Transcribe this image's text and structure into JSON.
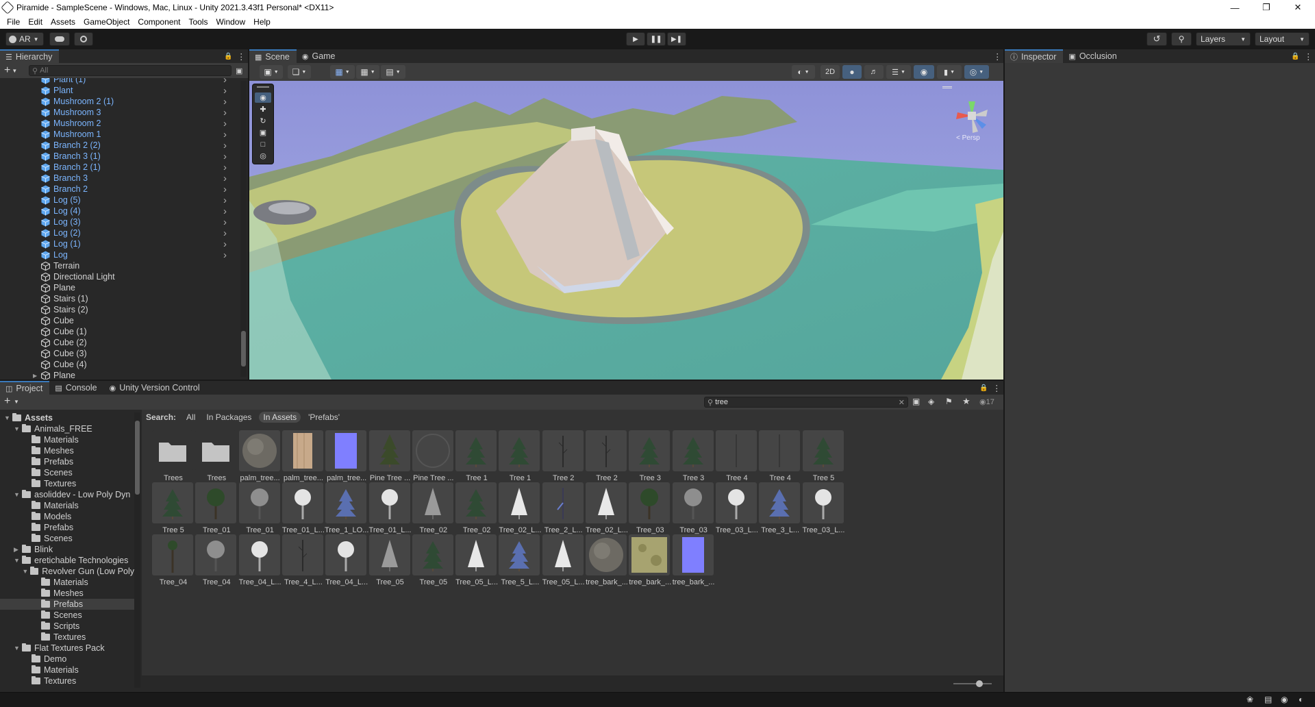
{
  "window": {
    "title": "Piramide - SampleScene - Windows, Mac, Linux - Unity 2021.3.43f1 Personal* <DX11>"
  },
  "menu": [
    "File",
    "Edit",
    "Assets",
    "GameObject",
    "Component",
    "Tools",
    "Window",
    "Help"
  ],
  "toolbar": {
    "account": "AR",
    "layers": "Layers",
    "layout": "Layout"
  },
  "hierarchy": {
    "tab": "Hierarchy",
    "search_placeholder": "All",
    "items": [
      {
        "label": "Plant (1)",
        "blue": true
      },
      {
        "label": "Plant",
        "blue": true
      },
      {
        "label": "Mushroom 2 (1)",
        "blue": true
      },
      {
        "label": "Mushroom 3",
        "blue": true
      },
      {
        "label": "Mushroom 2",
        "blue": true
      },
      {
        "label": "Mushroom 1",
        "blue": true
      },
      {
        "label": "Branch 2 (2)",
        "blue": true
      },
      {
        "label": "Branch 3 (1)",
        "blue": true
      },
      {
        "label": "Branch 2 (1)",
        "blue": true
      },
      {
        "label": "Branch 3",
        "blue": true
      },
      {
        "label": "Branch 2",
        "blue": true
      },
      {
        "label": "Log (5)",
        "blue": true
      },
      {
        "label": "Log (4)",
        "blue": true
      },
      {
        "label": "Log (3)",
        "blue": true
      },
      {
        "label": "Log (2)",
        "blue": true
      },
      {
        "label": "Log (1)",
        "blue": true
      },
      {
        "label": "Log",
        "blue": true
      },
      {
        "label": "Terrain",
        "blue": false
      },
      {
        "label": "Directional Light",
        "blue": false
      },
      {
        "label": "Plane",
        "blue": false
      },
      {
        "label": "Stairs (1)",
        "blue": false
      },
      {
        "label": "Stairs (2)",
        "blue": false
      },
      {
        "label": "Cube",
        "blue": false
      },
      {
        "label": "Cube (1)",
        "blue": false
      },
      {
        "label": "Cube (2)",
        "blue": false
      },
      {
        "label": "Cube (3)",
        "blue": false
      },
      {
        "label": "Cube (4)",
        "blue": false
      },
      {
        "label": "Plane",
        "blue": false
      }
    ]
  },
  "scene": {
    "tabs": [
      "Scene",
      "Game"
    ],
    "mode_2d": "2D",
    "gizmo_label": "< Persp"
  },
  "inspector": {
    "tabs": [
      "Inspector",
      "Occlusion"
    ]
  },
  "project": {
    "tabs": [
      "Project",
      "Console",
      "Unity Version Control"
    ],
    "search_value": "tree",
    "search_label": "Search:",
    "filters": [
      "All",
      "In Packages",
      "In Assets",
      "'Prefabs'"
    ],
    "result_count": "17",
    "tree": [
      {
        "label": "Assets",
        "depth": 0,
        "open": true,
        "bold": true
      },
      {
        "label": "Animals_FREE",
        "depth": 1,
        "open": true
      },
      {
        "label": "Materials",
        "depth": 2
      },
      {
        "label": "Meshes",
        "depth": 2
      },
      {
        "label": "Prefabs",
        "depth": 2
      },
      {
        "label": "Scenes",
        "depth": 2
      },
      {
        "label": "Textures",
        "depth": 2
      },
      {
        "label": "asoliddev - Low Poly Dyn",
        "depth": 1,
        "open": true
      },
      {
        "label": "Materials",
        "depth": 2
      },
      {
        "label": "Models",
        "depth": 2
      },
      {
        "label": "Prefabs",
        "depth": 2
      },
      {
        "label": "Scenes",
        "depth": 2
      },
      {
        "label": "Blink",
        "depth": 1,
        "open": false
      },
      {
        "label": "eretichable Technologies",
        "depth": 1,
        "open": true
      },
      {
        "label": "Revolver Gun (Low Poly",
        "depth": 2,
        "open": true
      },
      {
        "label": "Materials",
        "depth": 3
      },
      {
        "label": "Meshes",
        "depth": 3
      },
      {
        "label": "Prefabs",
        "depth": 3,
        "selected": true
      },
      {
        "label": "Scenes",
        "depth": 3
      },
      {
        "label": "Scripts",
        "depth": 3
      },
      {
        "label": "Textures",
        "depth": 3
      },
      {
        "label": "Flat Textures Pack",
        "depth": 1,
        "open": true
      },
      {
        "label": "Demo",
        "depth": 2
      },
      {
        "label": "Materials",
        "depth": 2
      },
      {
        "label": "Textures",
        "depth": 2
      }
    ],
    "assets": [
      {
        "label": "Trees",
        "kind": "folder"
      },
      {
        "label": "Trees",
        "kind": "folder"
      },
      {
        "label": "palm_tree...",
        "kind": "sphere"
      },
      {
        "label": "palm_tree...",
        "kind": "bark"
      },
      {
        "label": "palm_tree...",
        "kind": "normal"
      },
      {
        "label": "Pine Tree ...",
        "kind": "pine"
      },
      {
        "label": "Pine Tree ...",
        "kind": "ring"
      },
      {
        "label": "Tree 1",
        "kind": "conifer"
      },
      {
        "label": "Tree 1",
        "kind": "conifer"
      },
      {
        "label": "Tree 2",
        "kind": "stick"
      },
      {
        "label": "Tree 2",
        "kind": "stick"
      },
      {
        "label": "Tree 3",
        "kind": "conifer"
      },
      {
        "label": "Tree 3",
        "kind": "conifer"
      },
      {
        "label": "Tree 4",
        "kind": "line"
      },
      {
        "label": "Tree 4",
        "kind": "line"
      },
      {
        "label": "Tree 5",
        "kind": "conifer"
      },
      {
        "label": "Tree 5",
        "kind": "conifer"
      },
      {
        "label": "Tree_01",
        "kind": "round"
      },
      {
        "label": "Tree_01",
        "kind": "grayround"
      },
      {
        "label": "Tree_01_L...",
        "kind": "whiteround"
      },
      {
        "label": "Tree_1_LO...",
        "kind": "bluepine"
      },
      {
        "label": "Tree_01_L...",
        "kind": "whiteround"
      },
      {
        "label": "Tree_02",
        "kind": "graycone"
      },
      {
        "label": "Tree_02",
        "kind": "conifer"
      },
      {
        "label": "Tree_02_L...",
        "kind": "whitecone"
      },
      {
        "label": "Tree_2_L...",
        "kind": "bluestick"
      },
      {
        "label": "Tree_02_L...",
        "kind": "whitecone"
      },
      {
        "label": "Tree_03",
        "kind": "round"
      },
      {
        "label": "Tree_03",
        "kind": "grayround"
      },
      {
        "label": "Tree_03_L...",
        "kind": "whiteround"
      },
      {
        "label": "Tree_3_L...",
        "kind": "bluepine"
      },
      {
        "label": "Tree_03_L...",
        "kind": "whiteround"
      },
      {
        "label": "Tree_04",
        "kind": "tallround"
      },
      {
        "label": "Tree_04",
        "kind": "grayround"
      },
      {
        "label": "Tree_04_L...",
        "kind": "whiteround"
      },
      {
        "label": "Tree_4_L...",
        "kind": "stick"
      },
      {
        "label": "Tree_04_L...",
        "kind": "whiteround"
      },
      {
        "label": "Tree_05",
        "kind": "graycone"
      },
      {
        "label": "Tree_05",
        "kind": "conifer"
      },
      {
        "label": "Tree_05_L...",
        "kind": "whitecone"
      },
      {
        "label": "Tree_5_L...",
        "kind": "bluepine"
      },
      {
        "label": "Tree_05_L...",
        "kind": "whitecone"
      },
      {
        "label": "tree_bark_...",
        "kind": "sphere"
      },
      {
        "label": "tree_bark_...",
        "kind": "moss"
      },
      {
        "label": "tree_bark_...",
        "kind": "normal"
      }
    ]
  }
}
